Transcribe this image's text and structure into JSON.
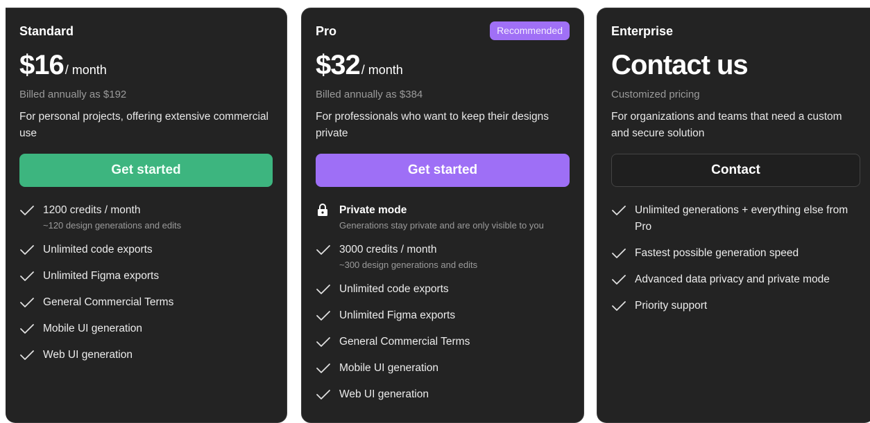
{
  "plans": [
    {
      "name": "Standard",
      "price": "$16",
      "period": "/ month",
      "billing": "Billed annually as $192",
      "description": "For personal projects, offering extensive commercial use",
      "cta": "Get started",
      "features": [
        {
          "title": "1200 credits / month",
          "subtitle": "~120 design generations and edits"
        },
        {
          "title": "Unlimited code exports"
        },
        {
          "title": "Unlimited Figma exports"
        },
        {
          "title": "General Commercial Terms"
        },
        {
          "title": "Mobile UI generation"
        },
        {
          "title": "Web UI generation"
        }
      ]
    },
    {
      "name": "Pro",
      "badge": "Recommended",
      "price": "$32",
      "period": "/ month",
      "billing": "Billed annually as $384",
      "description": "For professionals who want to keep their designs private",
      "cta": "Get started",
      "private_mode": {
        "title": "Private mode",
        "subtitle": "Generations stay private and are only visible to you"
      },
      "features": [
        {
          "title": "3000 credits / month",
          "subtitle": "~300 design generations and edits"
        },
        {
          "title": "Unlimited code exports"
        },
        {
          "title": "Unlimited Figma exports"
        },
        {
          "title": "General Commercial Terms"
        },
        {
          "title": "Mobile UI generation"
        },
        {
          "title": "Web UI generation"
        }
      ]
    },
    {
      "name": "Enterprise",
      "price": "Contact us",
      "billing": "Customized pricing",
      "description": "For organizations and teams that need a custom and secure solution",
      "cta": "Contact",
      "features": [
        {
          "title": "Unlimited generations + everything else from Pro"
        },
        {
          "title": "Fastest possible generation speed"
        },
        {
          "title": "Advanced data privacy and private mode"
        },
        {
          "title": "Priority support"
        }
      ]
    }
  ],
  "colors": {
    "card_bg": "#232323",
    "standard_cta": "#3db57f",
    "pro_cta": "#9e6ff6",
    "badge": "#a070f6"
  },
  "icons": {
    "check": "check-icon",
    "lock": "lock-icon"
  }
}
